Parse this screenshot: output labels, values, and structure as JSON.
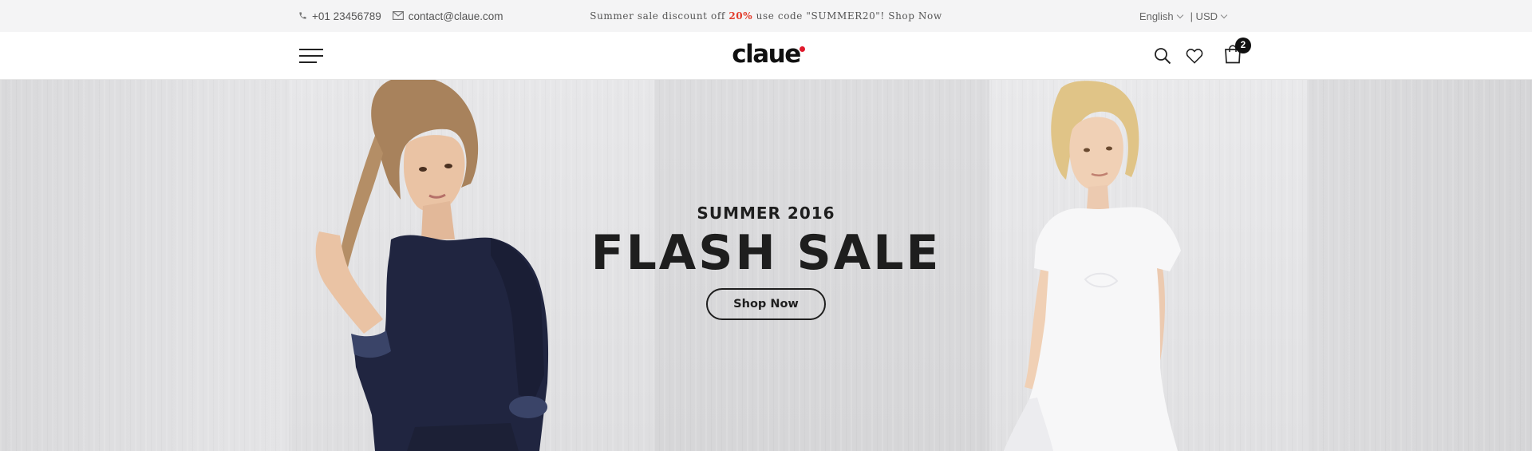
{
  "topbar": {
    "phone": "+01 23456789",
    "email": "contact@claue.com",
    "promo_prefix": "Summer sale discount off ",
    "promo_percent": "20%",
    "promo_suffix": " use code \"SUMMER20\"! Shop Now",
    "language": "English",
    "currency": "| USD"
  },
  "header": {
    "logo": "claue",
    "cart_count": "2"
  },
  "hero": {
    "subtitle": "SUMMER 2016",
    "title": "FLASH SALE",
    "button": "Shop Now"
  },
  "colors": {
    "accent": "#e23b2b",
    "logo_dot": "#e0192b",
    "text_dark": "#1e1e1e"
  },
  "icons": [
    "phone-icon",
    "mail-icon",
    "chevron-down-icon",
    "menu-icon",
    "search-icon",
    "heart-icon",
    "bag-icon"
  ]
}
